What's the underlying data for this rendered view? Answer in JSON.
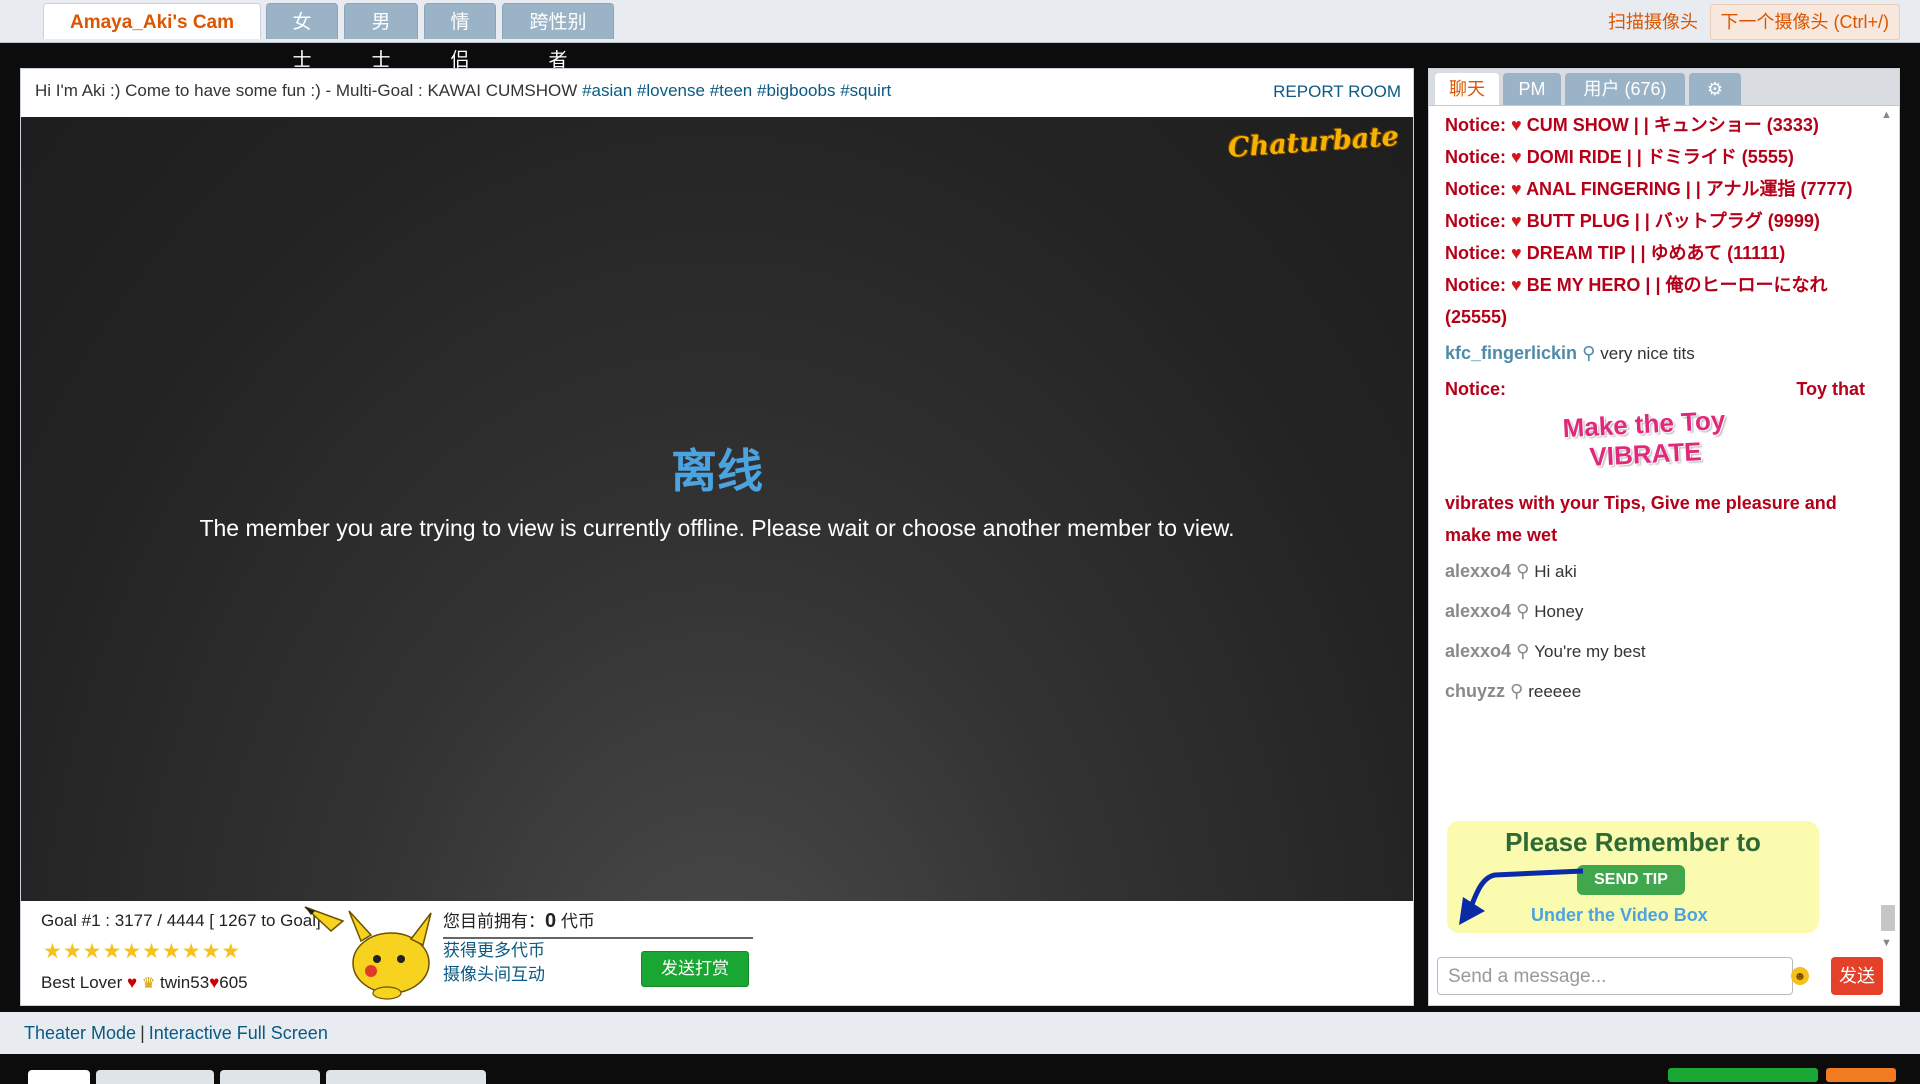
{
  "top_tabs": [
    "Amaya_Aki's Cam",
    "女士",
    "男士",
    "情侣",
    "跨性别者"
  ],
  "scan_cameras": "扫描摄像头",
  "next_camera": "下一个摄像头 (Ctrl+/)",
  "room": {
    "subject_text": "Hi I'm Aki :) Come to have some fun :) - Multi-Goal : KAWAI CUMSHOW",
    "hashtags": [
      "#asian",
      "#lovense",
      "#teen",
      "#bigboobs",
      "#squirt"
    ],
    "report": "REPORT ROOM",
    "logo": "Chaturbate",
    "offline_title": "离线",
    "offline_message": "The member you are trying to view is currently offline. Please wait or choose another member to view."
  },
  "goal": {
    "line": "Goal #1 : 3177 / 4444 [ 1267 to Goal]",
    "stars": "★★★★★★★★★★",
    "best_lover_prefix": "Best Lover",
    "best_lover_user": "twin53",
    "best_lover_amount": "605"
  },
  "tokens": {
    "label": "您目前拥有：",
    "amount": "0",
    "unit": "代币",
    "get_more": "获得更多代币",
    "cam2cam": "摄像头间互动",
    "send_tip": "发送打赏"
  },
  "chat": {
    "tabs": [
      "聊天",
      "PM",
      "用户 (676)"
    ],
    "notices": [
      {
        "prefix": "Notice:",
        "text": "CUM SHOW | | キュンショー (3333)"
      },
      {
        "prefix": "Notice:",
        "text": "DOMI RIDE | | ドミライド (5555)"
      },
      {
        "prefix": "Notice:",
        "text": "ANAL FINGERING | | アナル運指 (7777)"
      },
      {
        "prefix": "Notice:",
        "text": "BUTT PLUG | | バットプラグ (9999)"
      },
      {
        "prefix": "Notice:",
        "text": "DREAM TIP | | ゆめあて (11111)"
      },
      {
        "prefix": "Notice:",
        "text": "BE MY HERO | | 俺のヒーローになれ (25555)"
      }
    ],
    "msg1_user": "kfc_fingerlickin",
    "msg1_text": "very nice tits",
    "toy_notice_prefix": "Notice:",
    "toy_notice_right": "Toy that",
    "toy_image_text": "Make the Toy VIBRATE",
    "toy_notice_tail": "vibrates with your Tips, Give me pleasure and make me wet",
    "messages": [
      {
        "user": "alexxo4",
        "text": "Hi aki"
      },
      {
        "user": "alexxo4",
        "text": "Honey"
      },
      {
        "user": "alexxo4",
        "text": "You're my best"
      },
      {
        "user": "chuyzz",
        "text": "reeeee"
      }
    ],
    "remember_title": "Please Remember to",
    "remember_button": "SEND TIP",
    "remember_sub": "Under the Video Box",
    "input_placeholder": "Send a message...",
    "send": "发送"
  },
  "theater": {
    "mode": "Theater Mode",
    "separator": "|",
    "full": "Interactive Full Screen"
  },
  "colors": {
    "accent_orange": "#dc5500",
    "link_blue": "#0a5a83",
    "notice_red": "#b5001a",
    "tip_green": "#1aa632",
    "tab_blue": "#9bb3c7"
  }
}
